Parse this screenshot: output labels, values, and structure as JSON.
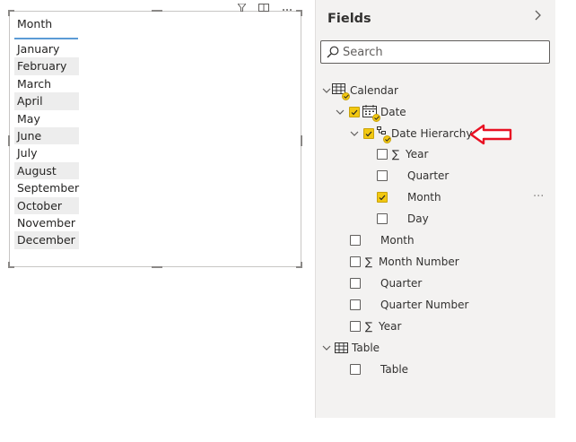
{
  "visual": {
    "column_header": "Month",
    "rows": [
      "January",
      "February",
      "March",
      "April",
      "May",
      "June",
      "July",
      "August",
      "September",
      "October",
      "November",
      "December"
    ]
  },
  "fields_pane": {
    "title": "Fields",
    "search_placeholder": "Search",
    "tree": {
      "calendar": "Calendar",
      "date": "Date",
      "date_hierarchy": "Date Hierarchy",
      "year_h": "Year",
      "quarter_h": "Quarter",
      "month_h": "Month",
      "day_h": "Day",
      "month": "Month",
      "month_number": "Month Number",
      "quarter": "Quarter",
      "quarter_number": "Quarter Number",
      "year": "Year",
      "table": "Table",
      "table_field": "Table"
    },
    "more_options": "···"
  },
  "colors": {
    "accent_yellow": "#f2c811",
    "arrow_red": "#e81123",
    "header_underline": "#5b9bd5"
  }
}
